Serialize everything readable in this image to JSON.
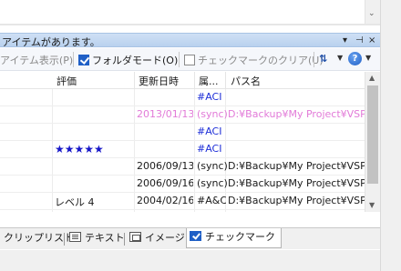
{
  "panel": {
    "title": "アイテムがあります。",
    "dropdown_glyph": "▾",
    "pin_glyph": "⊣",
    "close_glyph": "×"
  },
  "toolbar": {
    "item_display_label": "アイテム表示(P)",
    "folder_mode_label": "フォルダモード(O)",
    "folder_mode_checked": true,
    "clear_checks_label": "チェックマークのクリア(U)",
    "clear_checks_checked": false,
    "sort_glyph": "⇅",
    "help_glyph": "?"
  },
  "columns": {
    "rating": "評価",
    "modified": "更新日時",
    "attr": "属...",
    "path": "パス名"
  },
  "rows": [
    {
      "rating": "",
      "modified": "",
      "attr": "#ACI",
      "path": "",
      "style": "link"
    },
    {
      "rating": "",
      "modified": "2013/01/13 (",
      "attr": "(sync)",
      "path": "D:¥Backup¥My Project¥VSPr",
      "style": "pink"
    },
    {
      "rating": "",
      "modified": "",
      "attr": "#ACI",
      "path": "",
      "style": "link"
    },
    {
      "rating": "★★★★★",
      "modified": "",
      "attr": "#ACI",
      "path": "",
      "style": "link"
    },
    {
      "rating": "",
      "modified": "2006/09/13 ",
      "attr": "(sync)",
      "path": "D:¥Backup¥My Project¥VSPr",
      "style": "normal"
    },
    {
      "rating": "",
      "modified": "2006/09/16 (",
      "attr": "(sync)",
      "path": "D:¥Backup¥My Project¥VSPr",
      "style": "normal"
    },
    {
      "rating": "レベル 4",
      "modified": "2004/02/16 ",
      "attr": "#A&C",
      "path": "D:¥Backup¥My Project¥VSPr",
      "style": "normal"
    }
  ],
  "tabs": [
    {
      "label": "クリップリスト",
      "active": false
    },
    {
      "label": "テキスト",
      "active": false,
      "icon": "text-icon"
    },
    {
      "label": "イメージ",
      "active": false,
      "icon": "image-icon"
    },
    {
      "label": "チェックマーク",
      "active": true,
      "icon": "checkmark-icon"
    }
  ],
  "scroll": {
    "up_glyph": "▲",
    "down_glyph": "▼",
    "top_down_glyph": "⌄"
  }
}
